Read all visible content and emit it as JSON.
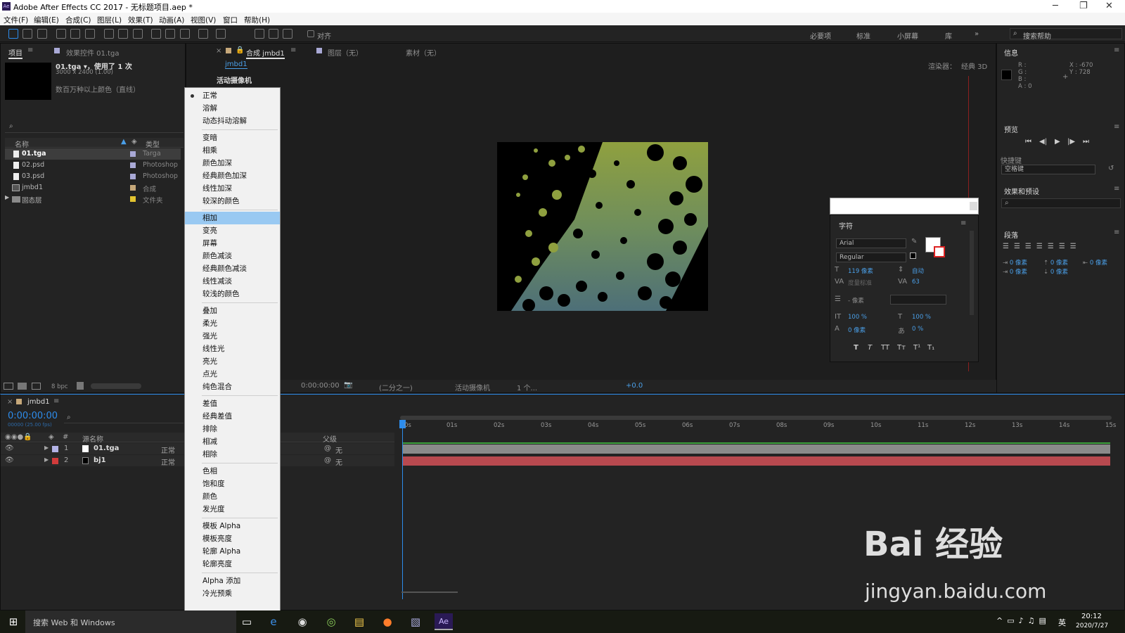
{
  "titlebar": {
    "logo": "Ae",
    "title": "Adobe After Effects CC 2017 - 无标题项目.aep *",
    "min": "─",
    "max": "❐",
    "close": "✕"
  },
  "menubar": [
    "文件(F)",
    "编辑(E)",
    "合成(C)",
    "图层(L)",
    "效果(T)",
    "动画(A)",
    "视图(V)",
    "窗口",
    "帮助(H)"
  ],
  "toolbar": {
    "align_label": "对齐",
    "workspaces": [
      "必要项",
      "标准",
      "小屏幕",
      "库"
    ],
    "search_placeholder": "搜索帮助"
  },
  "project_panel": {
    "tab_project": "项目",
    "tab_effects": "效果控件 01.tga",
    "file_line": "01.tga ▾，使用了 1 次",
    "dims": "3000 x 2400 (1.00)",
    "color_info": "数百万种以上颜色（直线）",
    "col_name": "名称",
    "col_type": "类型",
    "items": [
      {
        "name": "01.tga",
        "type": "Targa",
        "color": "#a9a9d6"
      },
      {
        "name": "02.psd",
        "type": "Photoshop",
        "color": "#a9a9d6"
      },
      {
        "name": "03.psd",
        "type": "Photoshop",
        "color": "#a9a9d6"
      },
      {
        "name": "jmbd1",
        "type": "合成",
        "color": "#c6a87a"
      },
      {
        "name": "固态层",
        "type": "文件夹",
        "color": "#e3c430"
      }
    ],
    "bpc": "8 bpc"
  },
  "comp_panel": {
    "tab_comp": "合成 jmbd1",
    "tab_layer": "图层（无）",
    "tab_footage": "素材（无）",
    "subtab": "jmbd1",
    "camera_label": "活动摄像机",
    "renderer": "渲染器：",
    "renderer_value": "经典 3D",
    "bottom_time": "0:00:00:00",
    "resolution": "(二分之一)",
    "camera_select": "活动摄像机",
    "views": "1 个...",
    "exposure": "+0.0"
  },
  "blend_menu": {
    "selected": "相加",
    "groups": [
      [
        "正常",
        "溶解",
        "动态抖动溶解"
      ],
      [
        "变暗",
        "相乘",
        "颜色加深",
        "经典颜色加深",
        "线性加深",
        "较深的颜色"
      ],
      [
        "相加",
        "变亮",
        "屏幕",
        "颜色减淡",
        "经典颜色减淡",
        "线性减淡",
        "较浅的颜色"
      ],
      [
        "叠加",
        "柔光",
        "强光",
        "线性光",
        "亮光",
        "点光",
        "纯色混合"
      ],
      [
        "差值",
        "经典差值",
        "排除",
        "相减",
        "相除"
      ],
      [
        "色相",
        "饱和度",
        "颜色",
        "发光度"
      ],
      [
        "模板 Alpha",
        "模板亮度",
        "轮廓 Alpha",
        "轮廓亮度"
      ],
      [
        "Alpha 添加",
        "冷光预乘"
      ]
    ]
  },
  "info_panel": {
    "title": "信息",
    "r": "R :",
    "g": "G :",
    "b": "B :",
    "a": "A : 0",
    "x": "X : -670",
    "y": "Y : 728"
  },
  "preview_panel": {
    "title": "预览",
    "shortcut_label": "快捷键",
    "shortcut_value": "空格键"
  },
  "effects_presets": {
    "title": "效果和预设"
  },
  "paragraph_panel": {
    "title": "段落",
    "v1": "0 像素",
    "v2": "0 像素",
    "v3": "0 像素",
    "v4": "0 像素",
    "v5": "0 像素"
  },
  "character_panel": {
    "title": "字符",
    "font": "Arial",
    "style": "Regular",
    "size": "119 像素",
    "leading": "自动",
    "kerning": "度量标准",
    "tracking": "63",
    "stroke": "- 像素",
    "vscale": "100 %",
    "hscale": "100 %",
    "baseline": "0 像素",
    "tsume": "0 %",
    "styles": [
      "T",
      "T",
      "TT",
      "Tт",
      "T¹",
      "T₁"
    ]
  },
  "timeline": {
    "tab": "jmbd1",
    "timecode": "0:00:00:00",
    "fps": "00000 (25.00 fps)",
    "col_num": "#",
    "col_source": "源名称",
    "col_parent": "父级",
    "layers": [
      {
        "num": "1",
        "name": "01.tga",
        "mode": "正常",
        "parent": "无",
        "color": "#b3b3e6"
      },
      {
        "num": "2",
        "name": "bj1",
        "mode": "正常",
        "parent": "无",
        "color": "#d13b3b"
      }
    ],
    "ruler": [
      "0s",
      "01s",
      "02s",
      "03s",
      "04s",
      "05s",
      "06s",
      "07s",
      "08s",
      "09s",
      "10s",
      "11s",
      "12s",
      "13s",
      "14s",
      "15s"
    ]
  },
  "taskbar": {
    "search": "搜索 Web 和 Windows",
    "time": "20:12",
    "date": "2020/7/27",
    "ime": "英"
  },
  "watermark": {
    "brand": "Bai 经验",
    "url": "jingyan.baidu.com"
  }
}
